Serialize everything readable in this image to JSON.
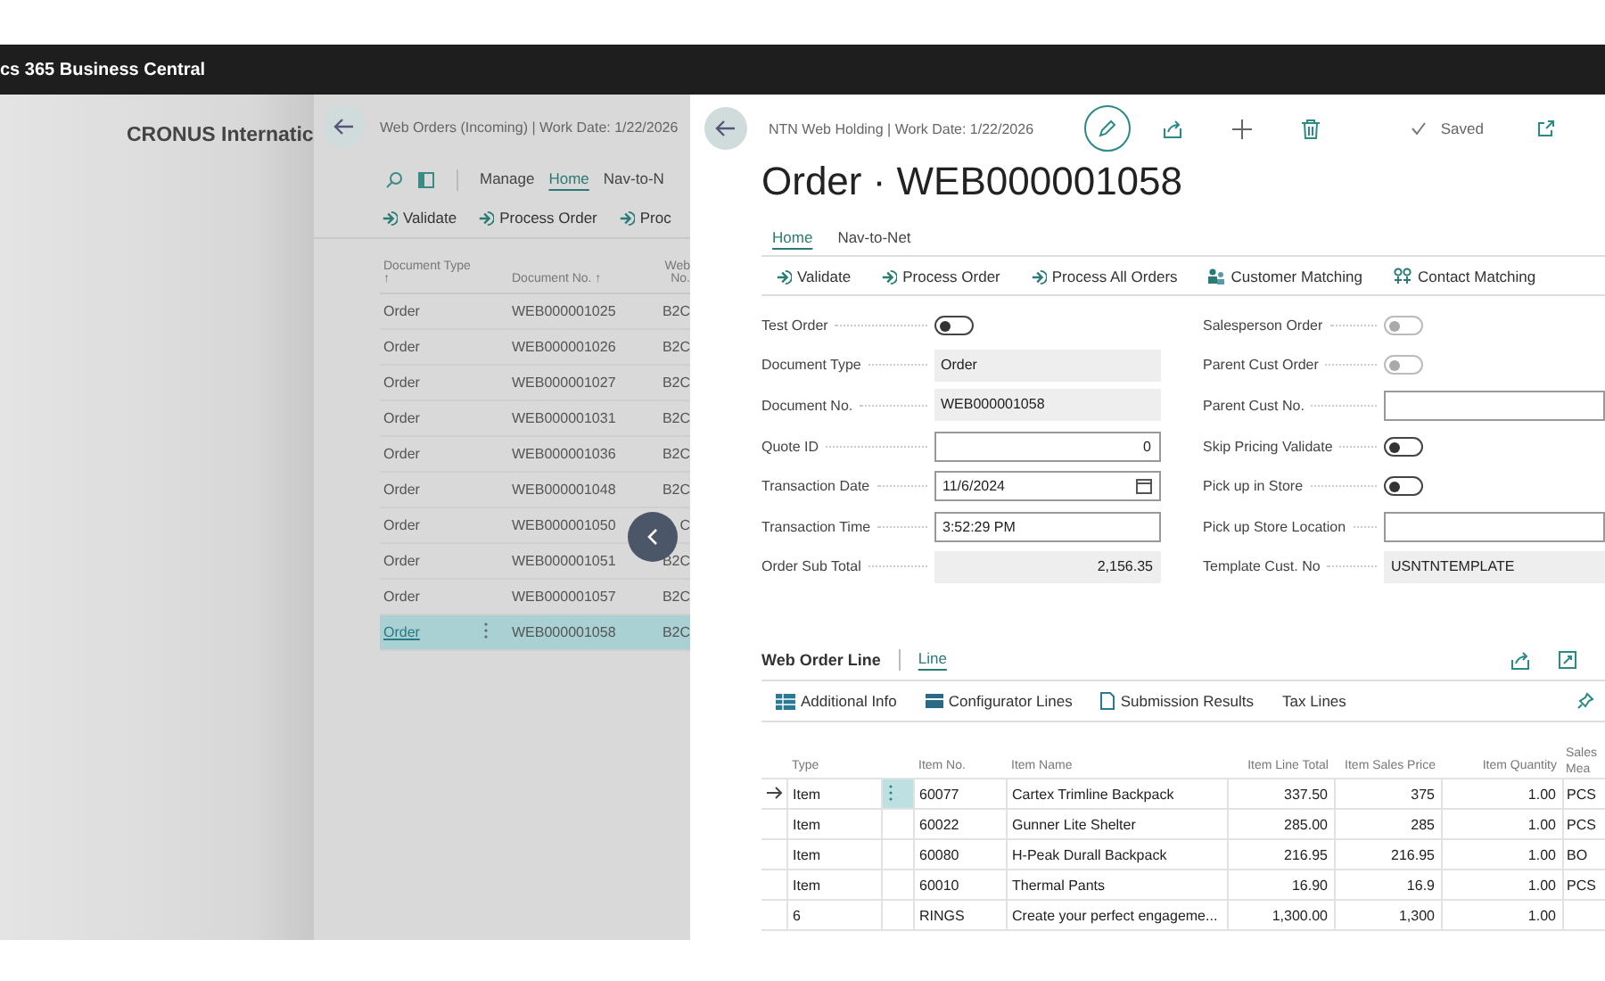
{
  "app_bar": {
    "title": "cs 365 Business Central"
  },
  "home": {
    "company": "CRONUS Internatic"
  },
  "list_page": {
    "breadcrumb": "Web Orders (Incoming) | Work Date: 1/22/2026",
    "tabs": [
      {
        "label": "Manage",
        "selected": false
      },
      {
        "label": "Home",
        "selected": true
      },
      {
        "label": "Nav-to-N",
        "selected": false
      }
    ],
    "actions": [
      "Validate",
      "Process Order",
      "Proc"
    ],
    "columns": [
      "Document Type ↑",
      "Document No. ↑",
      "Web No."
    ],
    "rows": [
      {
        "type": "Order",
        "doc_no": "WEB000001025",
        "web_no": "B2C",
        "selected": false
      },
      {
        "type": "Order",
        "doc_no": "WEB000001026",
        "web_no": "B2C",
        "selected": false
      },
      {
        "type": "Order",
        "doc_no": "WEB000001027",
        "web_no": "B2C",
        "selected": false
      },
      {
        "type": "Order",
        "doc_no": "WEB000001031",
        "web_no": "B2C",
        "selected": false
      },
      {
        "type": "Order",
        "doc_no": "WEB000001036",
        "web_no": "B2C",
        "selected": false
      },
      {
        "type": "Order",
        "doc_no": "WEB000001048",
        "web_no": "B2C",
        "selected": false
      },
      {
        "type": "Order",
        "doc_no": "WEB000001050",
        "web_no": "C",
        "selected": false
      },
      {
        "type": "Order",
        "doc_no": "WEB000001051",
        "web_no": "B2C",
        "selected": false
      },
      {
        "type": "Order",
        "doc_no": "WEB000001057",
        "web_no": "B2C",
        "selected": false
      },
      {
        "type": "Order",
        "doc_no": "WEB000001058",
        "web_no": "B2C",
        "selected": true
      }
    ]
  },
  "card": {
    "breadcrumb": "NTN Web Holding | Work Date: 1/22/2026",
    "saved": "Saved",
    "title": "Order · WEB000001058",
    "tabs": [
      {
        "label": "Home",
        "selected": true
      },
      {
        "label": "Nav-to-Net",
        "selected": false
      }
    ],
    "actions": [
      {
        "label": "Validate",
        "kind": "run"
      },
      {
        "label": "Process Order",
        "kind": "run"
      },
      {
        "label": "Process All Orders",
        "kind": "run"
      },
      {
        "label": "Customer Matching",
        "kind": "customers"
      },
      {
        "label": "Contact Matching",
        "kind": "contacts"
      }
    ],
    "fields_left": [
      {
        "label": "Test Order",
        "kind": "toggle",
        "on": false,
        "disabled": false
      },
      {
        "label": "Document Type",
        "kind": "readonly",
        "value": "Order"
      },
      {
        "label": "Document No.",
        "kind": "readonly",
        "value": "WEB000001058"
      },
      {
        "label": "Quote ID",
        "kind": "number",
        "value": "0"
      },
      {
        "label": "Transaction Date",
        "kind": "date",
        "value": "11/6/2024"
      },
      {
        "label": "Transaction Time",
        "kind": "text",
        "value": "3:52:29 PM"
      },
      {
        "label": "Order Sub Total",
        "kind": "readonly_number",
        "value": "2,156.35"
      }
    ],
    "fields_right": [
      {
        "label": "Salesperson Order",
        "kind": "toggle",
        "on": false,
        "disabled": true
      },
      {
        "label": "Parent Cust Order",
        "kind": "toggle",
        "on": false,
        "disabled": true
      },
      {
        "label": "Parent Cust No.",
        "kind": "text"
      },
      {
        "label": "Skip Pricing Validate",
        "kind": "toggle",
        "on": false,
        "disabled": false
      },
      {
        "label": "Pick up in Store",
        "kind": "toggle",
        "on": false,
        "disabled": false
      },
      {
        "label": "Pick up Store Location",
        "kind": "text"
      },
      {
        "label": "Template Cust. No",
        "kind": "readonly",
        "value": "USNTNTEMPLATE"
      }
    ]
  },
  "lines": {
    "title": "Web Order Line",
    "tabs": [
      {
        "label": "Line",
        "selected": true
      }
    ],
    "actions": [
      {
        "label": "Additional Info",
        "kind": "table"
      },
      {
        "label": "Configurator Lines",
        "kind": "list"
      },
      {
        "label": "Submission Results",
        "kind": "document"
      },
      {
        "label": "Tax Lines",
        "kind": "none"
      }
    ],
    "columns": [
      "Type",
      "Item No.",
      "Item Name",
      "Item Line Total",
      "Item Sales Price",
      "Item Quantity",
      "Sales Mea"
    ],
    "rows": [
      {
        "type": "Item",
        "item_no": "60077",
        "name": "Cartex Trimline Backpack",
        "total": "337.50",
        "price": "375",
        "qty": "1.00",
        "uom": "PCS",
        "current": true
      },
      {
        "type": "Item",
        "item_no": "60022",
        "name": "Gunner Lite Shelter",
        "total": "285.00",
        "price": "285",
        "qty": "1.00",
        "uom": "PCS",
        "current": false
      },
      {
        "type": "Item",
        "item_no": "60080",
        "name": "H-Peak Durall Backpack",
        "total": "216.95",
        "price": "216.95",
        "qty": "1.00",
        "uom": "BO",
        "current": false
      },
      {
        "type": "Item",
        "item_no": "60010",
        "name": "Thermal Pants",
        "total": "16.90",
        "price": "16.9",
        "qty": "1.00",
        "uom": "PCS",
        "current": false
      },
      {
        "type": "6",
        "item_no": "RINGS",
        "name": "Create your perfect engageme...",
        "total": "1,300.00",
        "price": "1,300",
        "qty": "1.00",
        "uom": "",
        "current": false
      }
    ]
  }
}
